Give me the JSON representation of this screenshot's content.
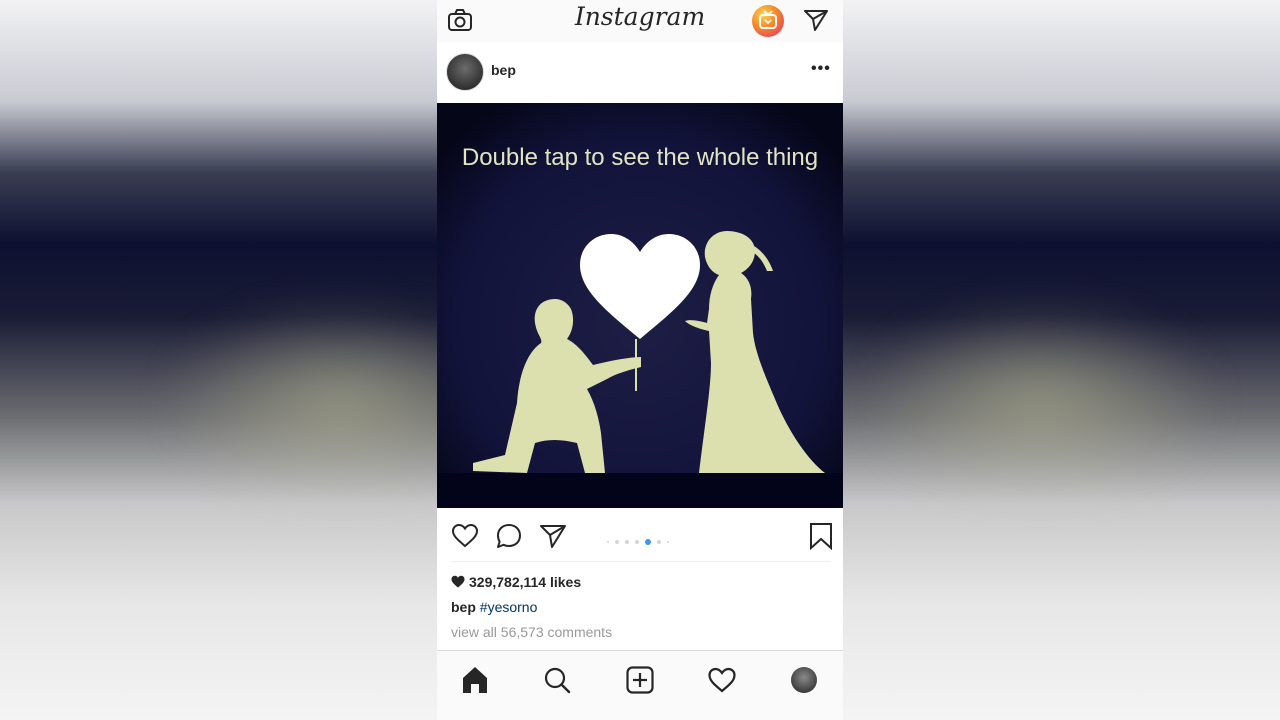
{
  "app": {
    "logo_text": "Instagram"
  },
  "icons": {
    "camera": "camera-icon",
    "igtv": "igtv-icon",
    "direct": "direct-message-icon",
    "more": "more-options-icon",
    "like": "heart-icon",
    "comment": "comment-icon",
    "share": "share-icon",
    "save": "bookmark-icon",
    "home": "home-icon",
    "search": "search-icon",
    "new_post": "add-post-icon",
    "activity": "activity-heart-icon"
  },
  "post": {
    "username": "bep",
    "image_text": "Double tap to see the whole thing",
    "likes": "329,782,114 likes",
    "caption_user": "bep",
    "caption_tag": "#yesorno",
    "comments_link": "view all 56,573 comments",
    "carousel": {
      "total": 7,
      "active_index": 4
    }
  },
  "colors": {
    "accent": "#3897f0",
    "hashtag": "#003569",
    "image_bg": "#0a0b2a",
    "silhouette": "#dcdfae"
  }
}
